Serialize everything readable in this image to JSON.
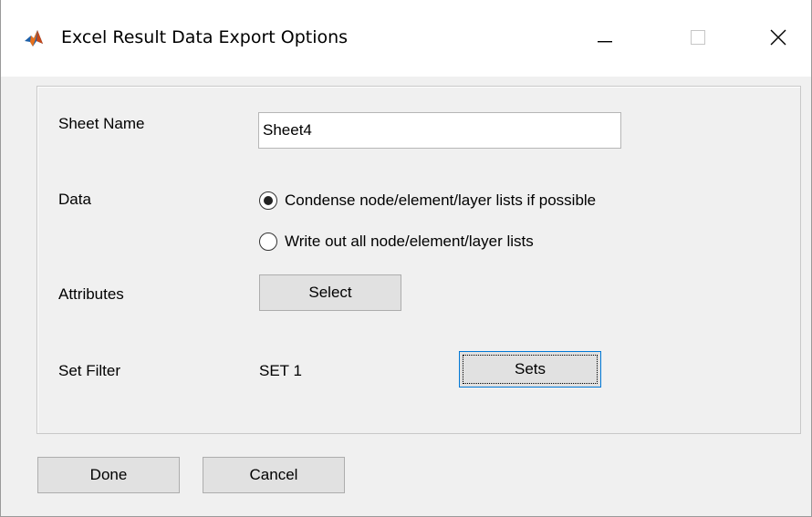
{
  "window": {
    "title": "Excel Result Data Export Options",
    "icon": "matlab-icon"
  },
  "title_controls": {
    "minimize_icon": "minimize-icon",
    "maximize_icon": "maximize-icon",
    "close_icon": "close-icon"
  },
  "sheet": {
    "label": "Sheet Name",
    "value": "Sheet4"
  },
  "data": {
    "label": "Data",
    "options": [
      {
        "label": "Condense node/element/layer lists if possible",
        "selected": true
      },
      {
        "label": "Write out all node/element/layer lists",
        "selected": false
      }
    ]
  },
  "attributes": {
    "label": "Attributes",
    "button": "Select"
  },
  "set_filter": {
    "label": "Set Filter",
    "value": "SET 1",
    "button": "Sets"
  },
  "footer": {
    "done": "Done",
    "cancel": "Cancel"
  },
  "colors": {
    "window_bg": "#f0f0f0",
    "button_bg": "#e1e1e1",
    "focus_border": "#0078d7"
  }
}
